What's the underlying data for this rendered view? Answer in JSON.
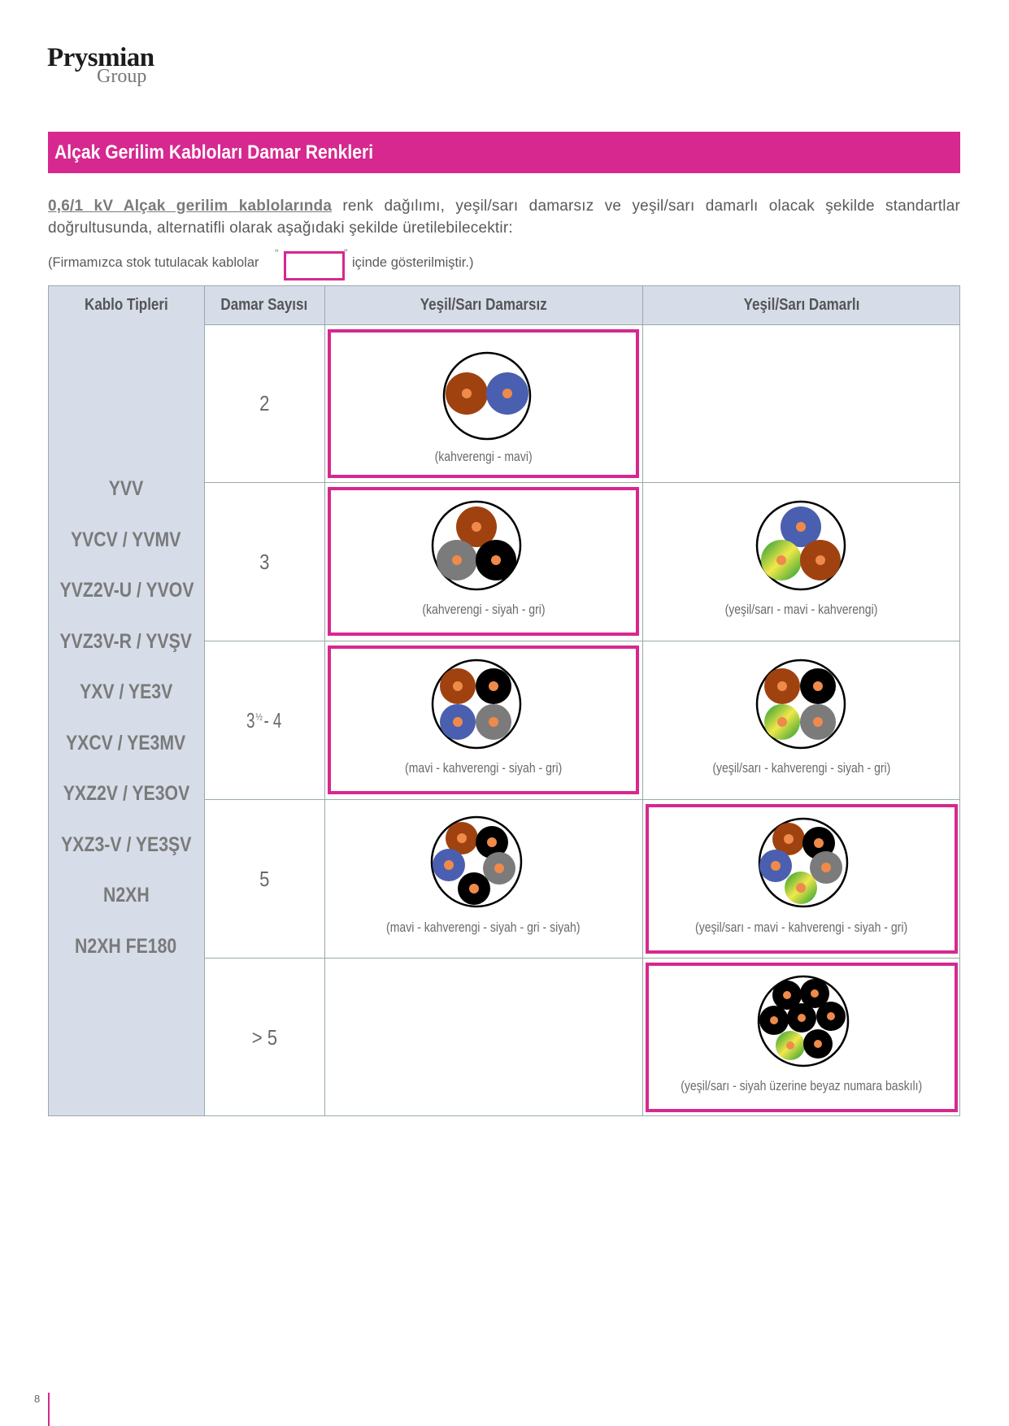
{
  "logo": {
    "name": "Prysmian",
    "sub": "Group"
  },
  "title": "Alçak Gerilim Kabloları Damar Renkleri",
  "intro": {
    "bold": "0,6/1 kV Alçak gerilim kablolarında",
    "rest": " renk dağılımı, yeşil/sarı damarsız ve yeşil/sarı damarlı olacak şekilde standartlar doğrultusunda, alternatifli olarak aşağıdaki şekilde üretilebilecektir:"
  },
  "stock_note": {
    "before": "(Firmamızca stok tutulacak kablolar",
    "quote_open": "“",
    "quote_close": "”",
    "after": "içinde gösterilmiştir.)"
  },
  "table": {
    "headers": [
      "Kablo Tipleri",
      "Damar Sayısı",
      "Yeşil/Sarı Damarsız",
      "Yeşil/Sarı Damarlı"
    ],
    "cable_types": [
      "YVV",
      "YVCV / YVMV",
      "YVZ2V-U / YVOV",
      "YVZ3V-R / YVŞV",
      "YXV / YE3V",
      "YXCV / YE3MV",
      "YXZ2V / YE3OV",
      "YXZ3-V / YE3ŞV",
      "N2XH",
      "N2XH FE180"
    ],
    "rows": [
      {
        "count": "2",
        "without_gy": "(kahverengi - mavi)",
        "without_stock": true,
        "with_gy": "",
        "with_stock": false
      },
      {
        "count": "3",
        "without_gy": "(kahverengi - siyah - gri)",
        "without_stock": true,
        "with_gy": "(yeşil/sarı - mavi - kahverengi)",
        "with_stock": false
      },
      {
        "count_main": "3",
        "count_sup": "½",
        "count_rest": " - 4",
        "without_gy": "(mavi - kahverengi - siyah - gri)",
        "without_stock": true,
        "with_gy": "(yeşil/sarı - kahverengi - siyah - gri)",
        "with_stock": false
      },
      {
        "count": "5",
        "without_gy": "(mavi - kahverengi - siyah - gri - siyah)",
        "without_stock": false,
        "with_gy": "(yeşil/sarı - mavi - kahverengi - siyah - gri)",
        "with_stock": true
      },
      {
        "count": "> 5",
        "without_gy": "",
        "without_stock": false,
        "with_gy": "(yeşil/sarı - siyah üzerine beyaz numara baskılı)",
        "with_stock": true
      }
    ]
  },
  "colors": {
    "accent": "#d6288f",
    "header_bg": "#d6dde9",
    "brown": "#a0420f",
    "blue": "#4a5fb0",
    "black": "#000000",
    "grey": "#7b7b7b",
    "copper": "#f08a4b"
  },
  "page_number": "8"
}
